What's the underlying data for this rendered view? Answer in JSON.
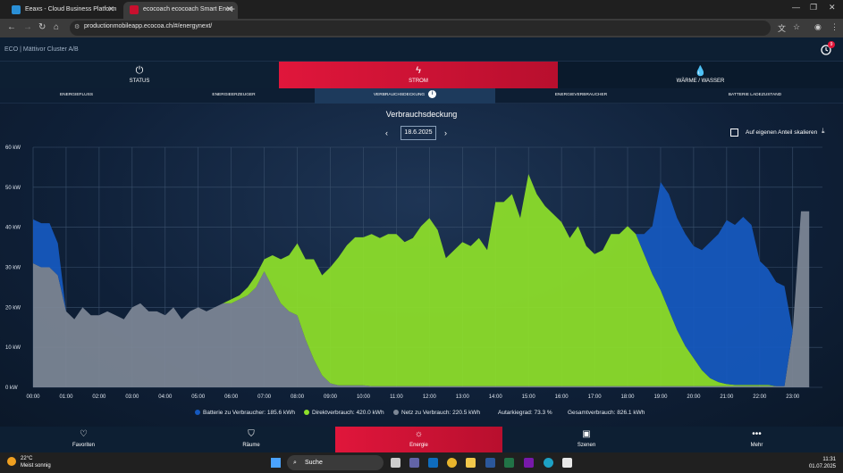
{
  "browser": {
    "tabs": [
      {
        "label": "Eeaxs - Cloud Business Platform"
      },
      {
        "label": "ecocoach ecocoach Smart Ener"
      }
    ],
    "url": "productionmobileapp.ecocoa.ch/#/energynext/"
  },
  "header": {
    "logo": "ECO | Mättivor Cluster A/B",
    "notification_count": "9"
  },
  "main_tabs": [
    {
      "label": "STATUS",
      "icon": "power-icon"
    },
    {
      "label": "STROM",
      "icon": "lightning-icon"
    },
    {
      "label": "WÄRME / WASSER",
      "icon": "drop-icon"
    }
  ],
  "sub_tabs": [
    {
      "label": "ENERGIEFLUSS"
    },
    {
      "label": "ENERGIEERZEUGER"
    },
    {
      "label": "VERBRAUCHSDECKUNG"
    },
    {
      "label": "ENERGIEVERBRAUCHER"
    },
    {
      "label": "BATTERIE LADEZUSTAND"
    }
  ],
  "content": {
    "title": "Verbrauchsdeckung",
    "date": "18.6.2025",
    "scale_option": "Auf eigenen Anteil skalieren"
  },
  "legend": {
    "battery": "Batterie zu Verbraucher: 185.6 kWh",
    "direct": "Direktverbrauch: 420.0 kWh",
    "grid": "Netz zu Verbrauch: 220.5 kWh",
    "autarky": "Autarkiegrad: 73.3 %",
    "total": "Gesamtverbrauch: 826.1 kWh"
  },
  "chart_data": {
    "type": "area",
    "stacked": true,
    "x_ticks": [
      "00:00",
      "01:00",
      "02:00",
      "03:00",
      "04:00",
      "05:00",
      "06:00",
      "07:00",
      "08:00",
      "09:00",
      "10:00",
      "11:00",
      "12:00",
      "13:00",
      "14:00",
      "15:00",
      "16:00",
      "17:00",
      "18:00",
      "19:00",
      "20:00",
      "21:00",
      "22:00",
      "23:00"
    ],
    "y_ticks": [
      "0 kW",
      "10 kW",
      "20 kW",
      "30 kW",
      "40 kW",
      "50 kW",
      "60 kW"
    ],
    "ylim": [
      0,
      60
    ],
    "x_hours": [
      0,
      0.25,
      0.5,
      0.75,
      1,
      1.25,
      1.5,
      1.75,
      2,
      2.25,
      2.5,
      2.75,
      3,
      3.25,
      3.5,
      3.75,
      4,
      4.25,
      4.5,
      4.75,
      5,
      5.25,
      5.5,
      5.75,
      6,
      6.25,
      6.5,
      6.75,
      7,
      7.25,
      7.5,
      7.75,
      8,
      8.25,
      8.5,
      8.75,
      9,
      9.25,
      9.5,
      9.75,
      10,
      10.25,
      10.5,
      10.75,
      11,
      11.25,
      11.5,
      11.75,
      12,
      12.25,
      12.5,
      12.75,
      13,
      13.25,
      13.5,
      13.75,
      14,
      14.25,
      14.5,
      14.75,
      15,
      15.25,
      15.5,
      15.75,
      16,
      16.25,
      16.5,
      16.75,
      17,
      17.25,
      17.5,
      17.75,
      18,
      18.25,
      18.5,
      18.75,
      19,
      19.25,
      19.5,
      19.75,
      20,
      20.25,
      20.5,
      20.75,
      21,
      21.25,
      21.5,
      21.75,
      22,
      22.25,
      22.5,
      22.75,
      23,
      23.25,
      23.5
    ],
    "series": [
      {
        "name": "Netz zu Verbrauch",
        "color": "#7d8796",
        "values": [
          31,
          30,
          30,
          28,
          19,
          17,
          20,
          18,
          18,
          19,
          18,
          17,
          20,
          21,
          19,
          19,
          18,
          20,
          17,
          19,
          20,
          19,
          20,
          21,
          21,
          22,
          23,
          25,
          29,
          25,
          21,
          19,
          18,
          12,
          7,
          3,
          1,
          0.5,
          0.5,
          0.5,
          0.5,
          0.3,
          0.3,
          0.3,
          0.3,
          0.3,
          0.3,
          0.3,
          0.3,
          0.3,
          0.3,
          0.3,
          0.3,
          0.3,
          0.3,
          0.3,
          0.3,
          0.3,
          0.3,
          0.3,
          0.3,
          0.3,
          0.3,
          0.3,
          0.3,
          0.3,
          0.3,
          0.3,
          0.3,
          0.3,
          0.3,
          0.3,
          0.3,
          0.3,
          0.3,
          0.3,
          0.3,
          0.3,
          0.3,
          0.3,
          0.3,
          0.3,
          0.3,
          0.3,
          0.3,
          0.3,
          0.3,
          0.3,
          0.3,
          0.3,
          0.3,
          0.3,
          14,
          44,
          44
        ]
      },
      {
        "name": "Direktverbrauch",
        "color": "#8ee02a",
        "values": [
          0,
          0,
          0,
          0,
          0,
          0,
          0,
          0,
          0,
          0,
          0,
          0,
          0,
          0,
          0,
          0,
          0,
          0,
          0,
          0,
          0,
          0,
          0,
          0,
          1,
          1,
          2,
          3,
          3,
          8,
          11,
          14,
          18,
          20,
          25,
          25,
          29,
          32,
          35,
          37,
          37,
          38,
          37,
          38,
          38,
          36,
          37,
          40,
          42,
          39,
          32,
          34,
          36,
          35,
          37,
          34,
          46,
          46,
          48,
          42,
          53,
          48,
          45,
          43,
          41,
          37,
          40,
          35,
          33,
          34,
          38,
          38,
          40,
          38,
          33,
          28,
          24,
          19,
          14,
          10,
          7,
          4,
          2,
          1,
          0.5,
          0.3,
          0.3,
          0.3,
          0.3,
          0.3,
          0,
          0,
          0,
          0,
          0
        ]
      },
      {
        "name": "Batterie zu Verbraucher",
        "color": "#1559c0",
        "values": [
          11,
          11,
          11,
          8,
          0,
          0,
          0,
          0,
          0,
          0,
          0,
          0,
          0,
          0,
          0,
          0,
          0,
          0,
          0,
          0,
          0,
          0,
          0,
          0,
          0,
          0,
          0,
          0,
          0,
          0,
          0,
          0,
          0,
          0,
          0,
          0,
          0,
          0,
          0,
          0,
          0,
          0,
          0,
          0,
          0,
          0,
          0,
          0,
          0,
          0,
          0,
          0,
          0,
          0,
          0,
          0,
          0,
          0,
          0,
          0,
          0,
          0,
          0,
          0,
          0,
          0,
          0,
          0,
          0,
          0,
          0,
          0,
          0,
          0,
          5,
          12,
          27,
          29,
          28,
          28,
          28,
          30,
          34,
          37,
          41,
          40,
          42,
          40,
          31,
          29,
          26,
          25,
          0,
          0,
          0
        ]
      }
    ]
  },
  "bottom_nav": [
    {
      "label": "Favoriten",
      "icon": "heart-icon"
    },
    {
      "label": "Räume",
      "icon": "shield-icon"
    },
    {
      "label": "Energie",
      "icon": "energy-icon"
    },
    {
      "label": "Szenen",
      "icon": "image-icon"
    },
    {
      "label": "Mehr",
      "icon": "more-icon"
    }
  ],
  "taskbar": {
    "weather_temp": "22°C",
    "weather_text": "Meist sonnig",
    "search_placeholder": "Suche",
    "time": "11:31",
    "date": "01.07.2025"
  }
}
